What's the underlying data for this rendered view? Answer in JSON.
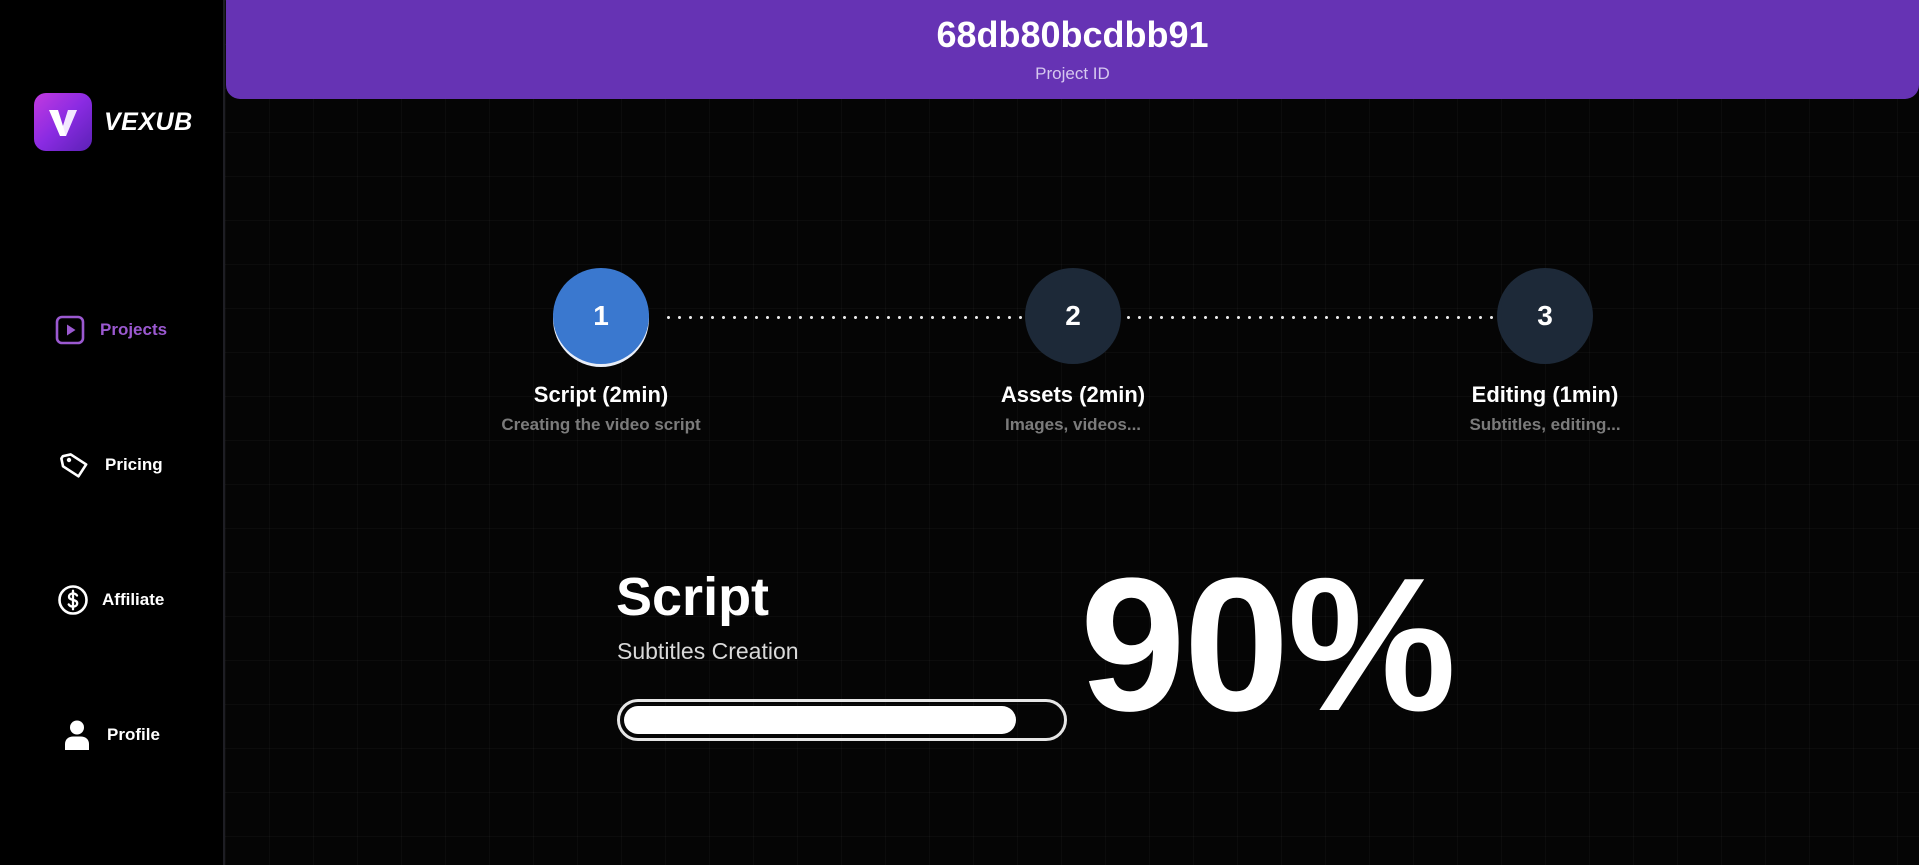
{
  "app": {
    "brand_name": "VEXUB"
  },
  "sidebar": {
    "items": [
      {
        "label": "Projects",
        "icon": "play-square-icon",
        "active": true
      },
      {
        "label": "Pricing",
        "icon": "price-tag-icon",
        "active": false
      },
      {
        "label": "Affiliate",
        "icon": "dollar-circle-icon",
        "active": false
      },
      {
        "label": "Profile",
        "icon": "user-icon",
        "active": false
      }
    ]
  },
  "header": {
    "project_id": "68db80bcdbb91",
    "project_id_label": "Project ID"
  },
  "steps": [
    {
      "number": "1",
      "title": "Script (2min)",
      "description": "Creating the video script",
      "state": "active"
    },
    {
      "number": "2",
      "title": "Assets (2min)",
      "description": "Images, videos...",
      "state": "pending"
    },
    {
      "number": "3",
      "title": "Editing (1min)",
      "description": "Subtitles, editing...",
      "state": "pending"
    }
  ],
  "progress": {
    "stage_title": "Script",
    "stage_subtitle": "Subtitles Creation",
    "percent_label": "90%",
    "value": 0.9
  },
  "colors": {
    "accent": "#6633b4",
    "active_nav": "#9b59d0",
    "active_step": "#3a78cf",
    "pending_step": "#1d2938"
  }
}
